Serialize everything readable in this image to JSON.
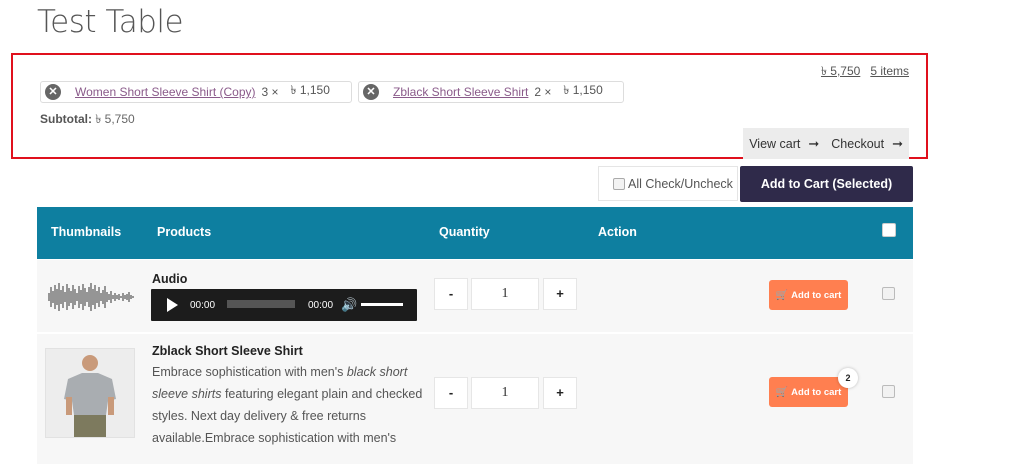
{
  "page": {
    "title": "Test Table"
  },
  "mini_cart": {
    "total": "৳ 5,750",
    "items_count": "5 items",
    "items": [
      {
        "name": "Women Short Sleeve Shirt (Copy)",
        "qty": "3 ×",
        "price": "৳ 1,150"
      },
      {
        "name": "Zblack Short Sleeve Shirt",
        "qty": "2 ×",
        "price": "৳ 1,150"
      }
    ],
    "subtotal_label": "Subtotal:",
    "subtotal_value": "৳ 5,750",
    "view_cart": "View cart",
    "checkout": "Checkout"
  },
  "toolbar": {
    "check_all_label": "All Check/Uncheck",
    "add_selected_label": "Add to Cart (Selected)"
  },
  "table": {
    "headers": {
      "thumbnails": "Thumbnails",
      "products": "Products",
      "quantity": "Quantity",
      "action": "Action"
    },
    "rows": [
      {
        "product": "Audio",
        "audio": {
          "current": "00:00",
          "duration": "00:00"
        },
        "minus": "-",
        "qty": "1",
        "plus": "+",
        "add_label": "Add to cart"
      },
      {
        "product": "Zblack Short Sleeve Shirt",
        "desc_1": "Embrace sophistication with men's ",
        "desc_italic": "black short sleeve shirts",
        "desc_2": " featuring elegant plain and checked styles. Next day delivery & free returns available.Embrace sophistication with men's",
        "minus": "-",
        "qty": "1",
        "plus": "+",
        "add_label": "Add to cart",
        "in_cart_badge": "2"
      }
    ]
  },
  "colors": {
    "header_bg": "#0e7fa0",
    "primary_button": "#2f2a4a",
    "add_button": "#ff7f50",
    "highlight_border": "#e0101d"
  },
  "icons": [
    "remove-icon",
    "right-arrow-icon",
    "cart-icon",
    "play-icon",
    "volume-icon",
    "checkbox"
  ]
}
